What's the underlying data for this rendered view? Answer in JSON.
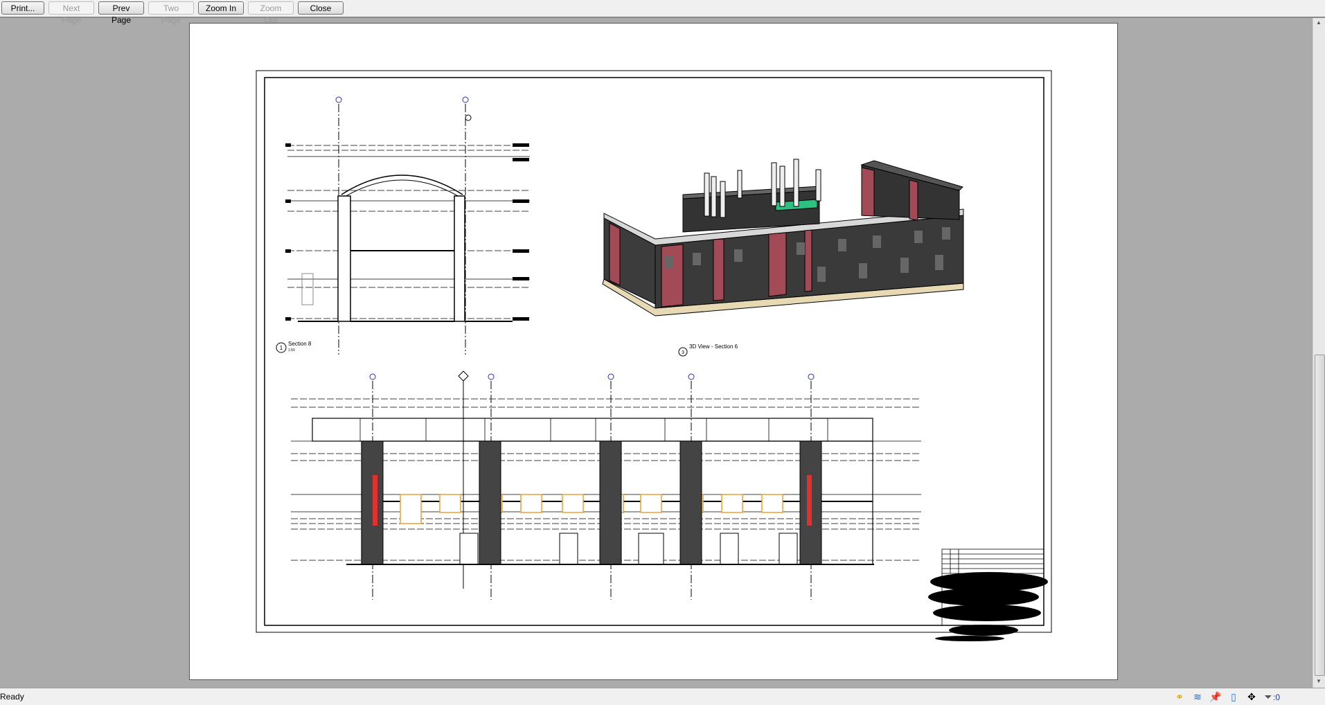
{
  "toolbar": {
    "buttons": [
      {
        "label": "Print...",
        "enabled": true
      },
      {
        "label": "Next Page",
        "enabled": false
      },
      {
        "label": "Prev Page",
        "enabled": true
      },
      {
        "label": "Two Page",
        "enabled": false
      },
      {
        "label": "Zoom In",
        "enabled": true
      },
      {
        "label": "Zoom Out",
        "enabled": false
      },
      {
        "label": "Close",
        "enabled": true
      }
    ]
  },
  "sheet": {
    "views": [
      {
        "number": "1",
        "title": "Section 8",
        "scale": "1:50"
      },
      {
        "number": "3",
        "title": "3D View - Section 6"
      }
    ]
  },
  "status": {
    "text": "Ready",
    "icons": [
      "link-select-icon",
      "underlay-select-icon",
      "pinned-select-icon",
      "face-select-icon",
      "drag-select-icon",
      "filter-icon"
    ],
    "filter_count": ":0"
  },
  "colors": {
    "brick_red": "#a24a55",
    "window_orange": "#f0a030",
    "accent_red": "#e03030",
    "slab_beige": "#e8d9b5"
  }
}
